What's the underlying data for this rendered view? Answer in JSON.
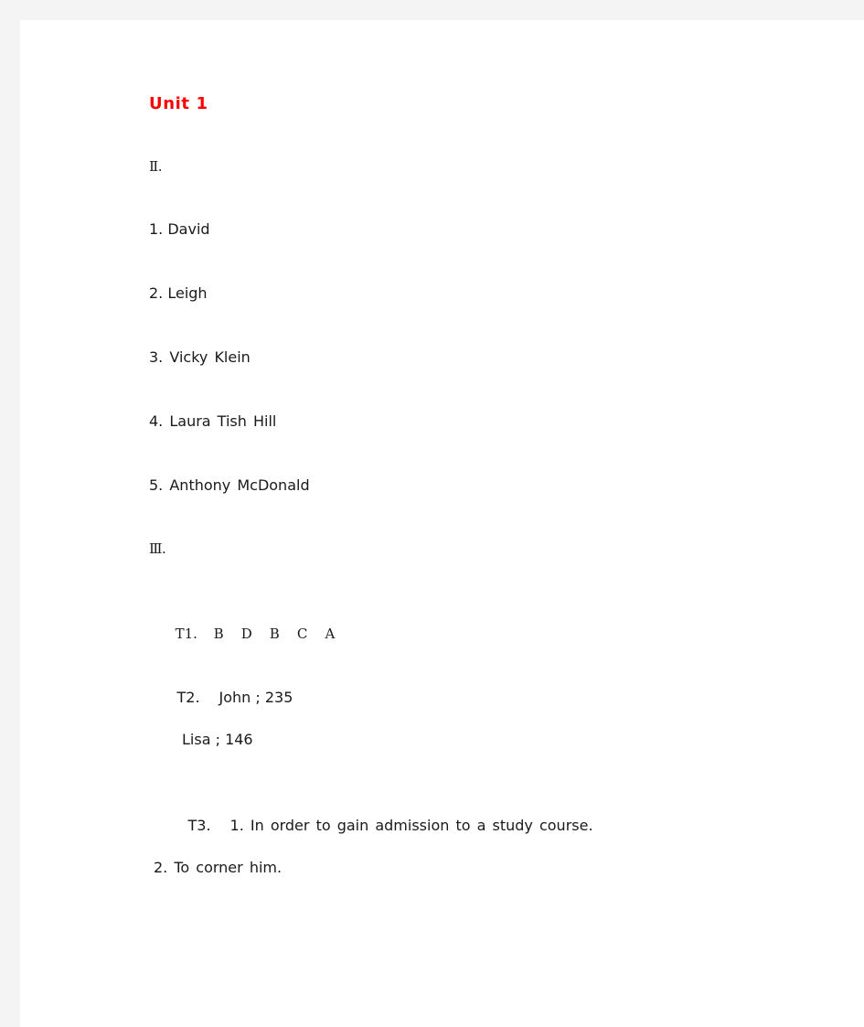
{
  "document": {
    "title": "Unit 1",
    "title_color": "#ff0000",
    "page_background": "#ffffff",
    "canvas_background": "#f4f4f4",
    "text_color": "#1a1a1a"
  },
  "sections": [
    {
      "marker": "Ⅱ.",
      "items": [
        "1. David",
        "2. Leigh",
        "3. Vicky Klein",
        "4. Laura Tish Hill",
        "5. Anthony McDonald"
      ]
    },
    {
      "marker": "Ⅲ.",
      "tasks": [
        {
          "label": "T1.",
          "letters": "B    D    B    C    A"
        },
        {
          "label": "T2.",
          "line1": "John ; 235",
          "line2": "Lisa ; 146"
        },
        {
          "label": "T3.",
          "line1": "1. In order to gain admission to a study course.",
          "line2": "2. To corner him."
        }
      ]
    }
  ]
}
